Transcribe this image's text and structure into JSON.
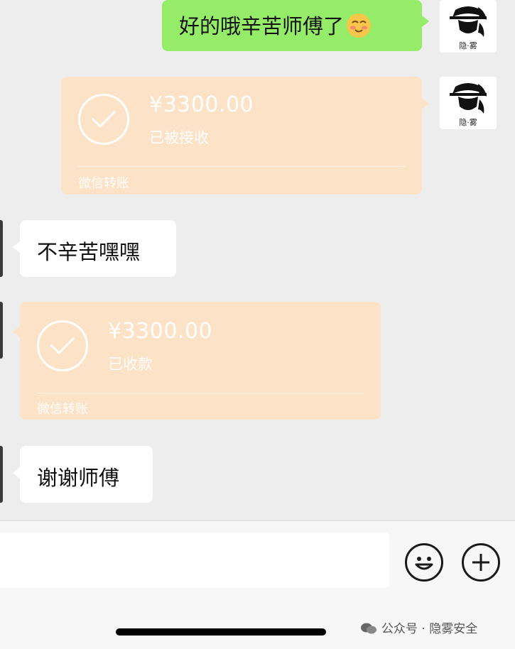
{
  "chat": {
    "messages": [
      {
        "text": "好的哦辛苦师傅了"
      },
      {
        "amount": "¥3300.00",
        "status": "已被接收",
        "brand": "微信转账"
      },
      {
        "text": "不辛苦嘿嘿"
      },
      {
        "amount": "¥3300.00",
        "status": "已收款",
        "brand": "微信转账"
      },
      {
        "text": "谢谢师傅"
      }
    ],
    "my_avatar_caption": "隐·雾"
  },
  "input": {
    "placeholder": ""
  },
  "watermark": {
    "text": "公众号 · 隐雾安全"
  },
  "colors": {
    "background": "#ededed",
    "sent_bubble": "#95ec69",
    "received_bubble": "#ffffff",
    "transfer_card": "#fce3c7"
  },
  "icons": [
    "emoji-icon",
    "plus-icon",
    "check-icon",
    "wechat-logo-icon"
  ]
}
